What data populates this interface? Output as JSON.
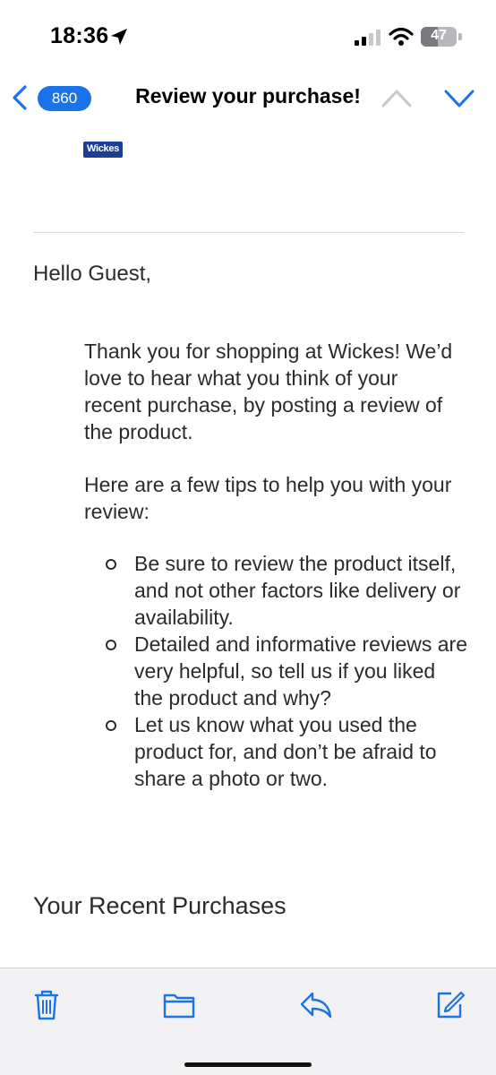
{
  "status_bar": {
    "time": "18:36",
    "battery_level": "47"
  },
  "nav": {
    "unread_count": "860",
    "title": "Review your purchase!"
  },
  "email": {
    "logo_text": "Wickes",
    "greeting": "Hello Guest,",
    "para1": "Thank you for shopping at Wickes! We’d love to hear what you think of your recent purchase, by posting a review of the product.",
    "para2": "Here are a few tips to help you with your review:",
    "tips": [
      "Be sure to review the product itself, and not other factors like delivery or availability.",
      "Detailed and informative reviews are very helpful, so tell us if you liked the product and why?",
      "Let us know what you used the product for, and don’t be afraid to share a photo or two."
    ],
    "recent_heading": "Your Recent Purchases"
  },
  "toolbar": {
    "icons": [
      "trash-icon",
      "folder-icon",
      "reply-icon",
      "compose-icon"
    ]
  },
  "colors": {
    "accent": "#1a73e8",
    "brand": "#1c3f94"
  }
}
